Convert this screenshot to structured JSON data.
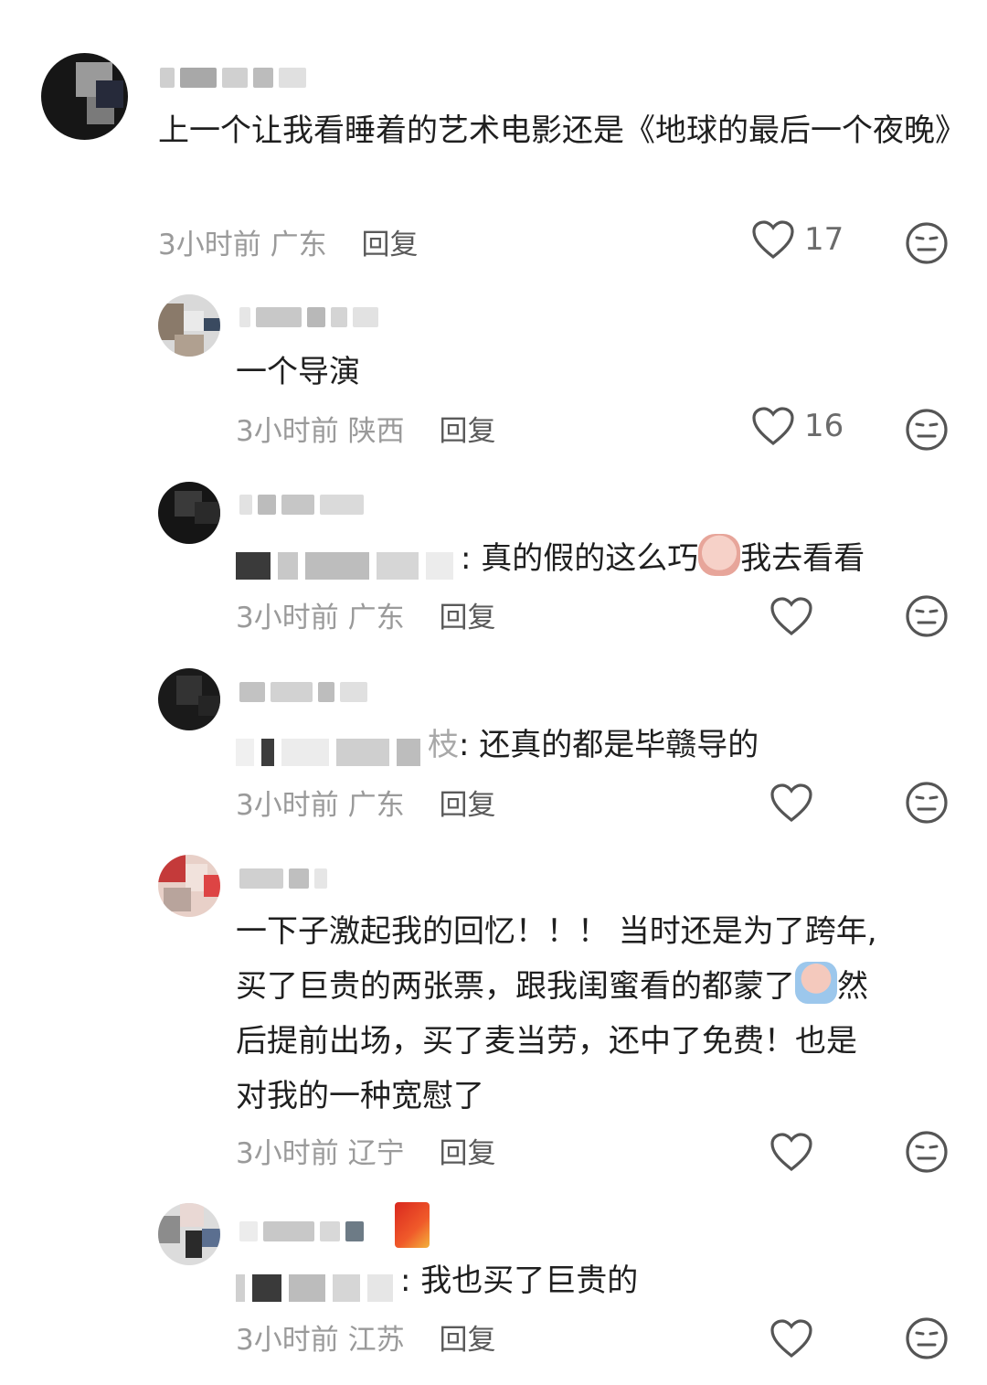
{
  "comments": [
    {
      "text": "上一个让我看睡着的艺术电影还是《地球的最后一个夜晚》",
      "time": "3小时前",
      "location": "广东",
      "reply_label": "回复",
      "likes": "17"
    },
    {
      "text": "一个导演",
      "time": "3小时前",
      "location": "陕西",
      "reply_label": "回复",
      "likes": "16"
    },
    {
      "text_pre": ": 真的假的这么巧",
      "text_post": "我去看看",
      "time": "3小时前",
      "location": "广东",
      "reply_label": "回复"
    },
    {
      "mention_tail": "枝",
      "text": ": 还真的都是毕赣导的",
      "time": "3小时前",
      "location": "广东",
      "reply_label": "回复"
    },
    {
      "text_l1": "一下子激起我的回忆！！！ 当时还是为了跨年,",
      "text_l2a": "买了巨贵的两张票，跟我闺蜜看的都蒙了",
      "text_l2b": "然",
      "text_l3": "后提前出场，买了麦当劳，还中了免费！也是",
      "text_l4": "对我的一种宽慰了",
      "time": "3小时前",
      "location": "辽宁",
      "reply_label": "回复"
    },
    {
      "text": ": 我也买了巨贵的",
      "time": "3小时前",
      "location": "江苏",
      "reply_label": "回复"
    }
  ],
  "icons": {
    "like": "heart-outline-icon",
    "dislike": "meh-face-icon",
    "emoji_surprised": "surprised-peach-emoji",
    "emoji_crying": "crying-peach-emoji",
    "badge": "red-envelope-badge"
  }
}
